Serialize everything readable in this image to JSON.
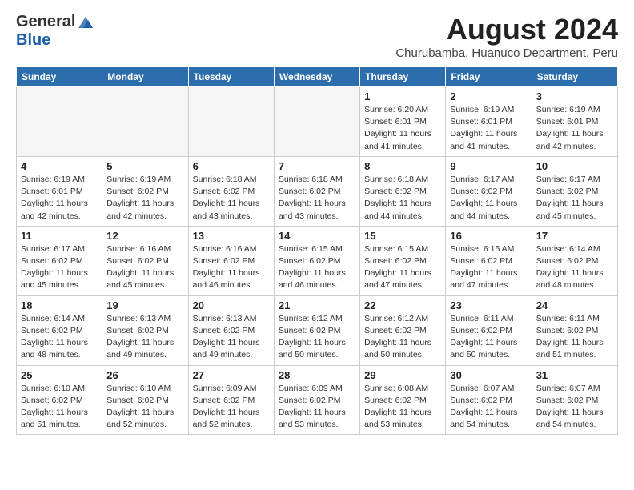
{
  "header": {
    "logo_general": "General",
    "logo_blue": "Blue",
    "main_title": "August 2024",
    "subtitle": "Churubamba, Huanuco Department, Peru"
  },
  "columns": [
    "Sunday",
    "Monday",
    "Tuesday",
    "Wednesday",
    "Thursday",
    "Friday",
    "Saturday"
  ],
  "weeks": [
    [
      {
        "day": "",
        "info": ""
      },
      {
        "day": "",
        "info": ""
      },
      {
        "day": "",
        "info": ""
      },
      {
        "day": "",
        "info": ""
      },
      {
        "day": "1",
        "info": "Sunrise: 6:20 AM\nSunset: 6:01 PM\nDaylight: 11 hours and 41 minutes."
      },
      {
        "day": "2",
        "info": "Sunrise: 6:19 AM\nSunset: 6:01 PM\nDaylight: 11 hours and 41 minutes."
      },
      {
        "day": "3",
        "info": "Sunrise: 6:19 AM\nSunset: 6:01 PM\nDaylight: 11 hours and 42 minutes."
      }
    ],
    [
      {
        "day": "4",
        "info": "Sunrise: 6:19 AM\nSunset: 6:01 PM\nDaylight: 11 hours and 42 minutes."
      },
      {
        "day": "5",
        "info": "Sunrise: 6:19 AM\nSunset: 6:02 PM\nDaylight: 11 hours and 42 minutes."
      },
      {
        "day": "6",
        "info": "Sunrise: 6:18 AM\nSunset: 6:02 PM\nDaylight: 11 hours and 43 minutes."
      },
      {
        "day": "7",
        "info": "Sunrise: 6:18 AM\nSunset: 6:02 PM\nDaylight: 11 hours and 43 minutes."
      },
      {
        "day": "8",
        "info": "Sunrise: 6:18 AM\nSunset: 6:02 PM\nDaylight: 11 hours and 44 minutes."
      },
      {
        "day": "9",
        "info": "Sunrise: 6:17 AM\nSunset: 6:02 PM\nDaylight: 11 hours and 44 minutes."
      },
      {
        "day": "10",
        "info": "Sunrise: 6:17 AM\nSunset: 6:02 PM\nDaylight: 11 hours and 45 minutes."
      }
    ],
    [
      {
        "day": "11",
        "info": "Sunrise: 6:17 AM\nSunset: 6:02 PM\nDaylight: 11 hours and 45 minutes."
      },
      {
        "day": "12",
        "info": "Sunrise: 6:16 AM\nSunset: 6:02 PM\nDaylight: 11 hours and 45 minutes."
      },
      {
        "day": "13",
        "info": "Sunrise: 6:16 AM\nSunset: 6:02 PM\nDaylight: 11 hours and 46 minutes."
      },
      {
        "day": "14",
        "info": "Sunrise: 6:15 AM\nSunset: 6:02 PM\nDaylight: 11 hours and 46 minutes."
      },
      {
        "day": "15",
        "info": "Sunrise: 6:15 AM\nSunset: 6:02 PM\nDaylight: 11 hours and 47 minutes."
      },
      {
        "day": "16",
        "info": "Sunrise: 6:15 AM\nSunset: 6:02 PM\nDaylight: 11 hours and 47 minutes."
      },
      {
        "day": "17",
        "info": "Sunrise: 6:14 AM\nSunset: 6:02 PM\nDaylight: 11 hours and 48 minutes."
      }
    ],
    [
      {
        "day": "18",
        "info": "Sunrise: 6:14 AM\nSunset: 6:02 PM\nDaylight: 11 hours and 48 minutes."
      },
      {
        "day": "19",
        "info": "Sunrise: 6:13 AM\nSunset: 6:02 PM\nDaylight: 11 hours and 49 minutes."
      },
      {
        "day": "20",
        "info": "Sunrise: 6:13 AM\nSunset: 6:02 PM\nDaylight: 11 hours and 49 minutes."
      },
      {
        "day": "21",
        "info": "Sunrise: 6:12 AM\nSunset: 6:02 PM\nDaylight: 11 hours and 50 minutes."
      },
      {
        "day": "22",
        "info": "Sunrise: 6:12 AM\nSunset: 6:02 PM\nDaylight: 11 hours and 50 minutes."
      },
      {
        "day": "23",
        "info": "Sunrise: 6:11 AM\nSunset: 6:02 PM\nDaylight: 11 hours and 50 minutes."
      },
      {
        "day": "24",
        "info": "Sunrise: 6:11 AM\nSunset: 6:02 PM\nDaylight: 11 hours and 51 minutes."
      }
    ],
    [
      {
        "day": "25",
        "info": "Sunrise: 6:10 AM\nSunset: 6:02 PM\nDaylight: 11 hours and 51 minutes."
      },
      {
        "day": "26",
        "info": "Sunrise: 6:10 AM\nSunset: 6:02 PM\nDaylight: 11 hours and 52 minutes."
      },
      {
        "day": "27",
        "info": "Sunrise: 6:09 AM\nSunset: 6:02 PM\nDaylight: 11 hours and 52 minutes."
      },
      {
        "day": "28",
        "info": "Sunrise: 6:09 AM\nSunset: 6:02 PM\nDaylight: 11 hours and 53 minutes."
      },
      {
        "day": "29",
        "info": "Sunrise: 6:08 AM\nSunset: 6:02 PM\nDaylight: 11 hours and 53 minutes."
      },
      {
        "day": "30",
        "info": "Sunrise: 6:07 AM\nSunset: 6:02 PM\nDaylight: 11 hours and 54 minutes."
      },
      {
        "day": "31",
        "info": "Sunrise: 6:07 AM\nSunset: 6:02 PM\nDaylight: 11 hours and 54 minutes."
      }
    ]
  ]
}
